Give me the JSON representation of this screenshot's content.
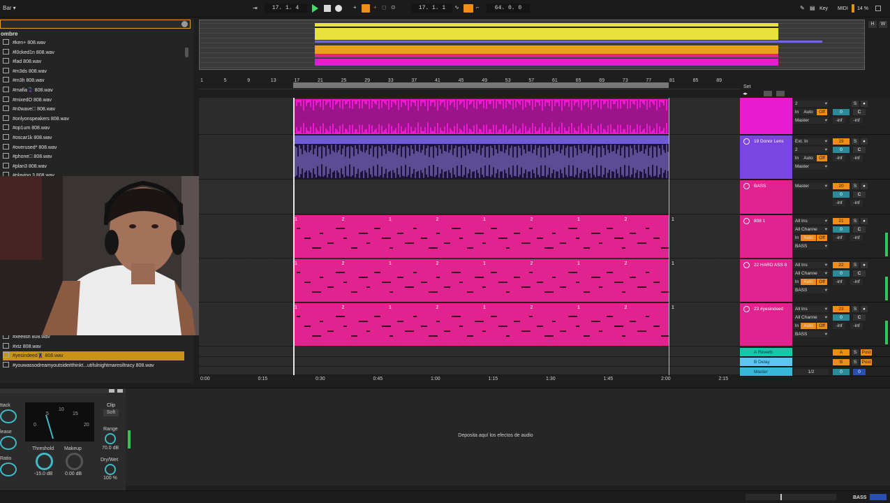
{
  "topbar": {
    "left_menu": "Bar",
    "arr_position": "17.  1.  4",
    "loop_start": "17.  1.  1",
    "loop_length": "64.  0.  0",
    "key_label": "Key",
    "midi_label": "MIDI",
    "cpu": "14 %",
    "btn_h": "H",
    "btn_w": "W"
  },
  "browser": {
    "column_header": "ombre",
    "files": [
      "#ken+ 808.wav",
      "#l0cked1n 808.wav",
      "#lad 808.wav",
      "#m3ds 808.wav",
      "#m3h 808.wav",
      "#mafia🦹 808.wav",
      "#mixedO 808.wav",
      "#n0wave🗆 808.wav",
      "#onlyonspeakers 808.wav",
      "#op1um 808.wav",
      "#oscar1k 808.wav",
      "#overused* 808.wav",
      "#phone🗆 808.wav",
      "#plan3 808.wav",
      "#playing 3 808.wav"
    ],
    "files_bottom": [
      "#xeelish 808.wav",
      "#xtz 808.wav"
    ],
    "selected_file": "#yesindeed🦹 808.wav",
    "last_file": "#youwassodreamyoutsideitthinkt...utifulnightmaresiltracy 808.wav"
  },
  "ruler": [
    "1",
    "5",
    "9",
    "13",
    "17",
    "21",
    "25",
    "29",
    "33",
    "37",
    "41",
    "45",
    "49",
    "53",
    "57",
    "61",
    "65",
    "69",
    "73",
    "77",
    "81",
    "85",
    "89"
  ],
  "time_ruler": [
    "0:00",
    "0:15",
    "0:30",
    "0:45",
    "1:00",
    "1:15",
    "1:30",
    "1:45",
    "2:00",
    "2:15"
  ],
  "clip_markers": [
    "1",
    "2",
    "1",
    "2",
    "1",
    "2",
    "1",
    "2",
    "1"
  ],
  "set_label": "Set",
  "tracks": [
    {
      "name": "",
      "color": "#ea1ad1",
      "in": "",
      "ch": "2",
      "monitor": [
        "In",
        "Auto",
        "Off"
      ],
      "out": "Master",
      "num": "",
      "vol": "0",
      "pan": "C",
      "a": "-inf",
      "b": "-inf"
    },
    {
      "name": "19 Donor Lens",
      "color": "#7b45e4",
      "in": "Ext. In",
      "ch": "2",
      "monitor": [
        "In",
        "Auto",
        "Off"
      ],
      "out": "Master",
      "num": "19",
      "vol": "0",
      "pan": "C",
      "a": "-inf",
      "b": "-inf"
    },
    {
      "name": "BASS",
      "color": "#e2238f",
      "in": "",
      "ch": "",
      "monitor": [],
      "out": "Master",
      "num": "20",
      "vol": "0",
      "pan": "C",
      "a": "-inf",
      "b": "-inf"
    },
    {
      "name": "808 1",
      "color": "#e2238f",
      "in": "All Ins",
      "ch": "All Channe",
      "monitor": [
        "In",
        "Auto",
        "Off"
      ],
      "out": "BASS",
      "num": "21",
      "vol": "0",
      "pan": "C",
      "a": "-inf",
      "b": "-inf"
    },
    {
      "name": "22 HARD ASS 8",
      "color": "#e2238f",
      "in": "All Ins",
      "ch": "All Channe",
      "monitor": [
        "In",
        "Auto",
        "Off"
      ],
      "out": "BASS",
      "num": "22",
      "vol": "0",
      "pan": "C",
      "a": "-inf",
      "b": "-inf"
    },
    {
      "name": "23 #yesindeed",
      "color": "#e2238f",
      "in": "All Ins",
      "ch": "All Channe",
      "monitor": [
        "In",
        "Auto",
        "Off"
      ],
      "out": "BASS",
      "num": "23",
      "vol": "0",
      "pan": "C",
      "a": "-inf",
      "b": "-inf"
    }
  ],
  "returns": [
    {
      "name": "A Reverb",
      "color": "#17c7a8",
      "letter": "A",
      "post": "Post"
    },
    {
      "name": "B Delay",
      "color": "#5cc6ef",
      "letter": "B",
      "post": "Post"
    },
    {
      "name": "Master",
      "color": "#37b8d7",
      "out": "1/2",
      "vol": "0",
      "pan": "0"
    }
  ],
  "compressor": {
    "attack_label": "ttack",
    "release_label": "lease",
    "ratio_label": "Ratio",
    "clip_label": "Clip",
    "soft_label": "Soft",
    "range_label": "Range",
    "range_value": "70.0 dB",
    "threshold_label": "Threshold",
    "threshold_value": "-15.0 dB",
    "makeup_label": "Makeup",
    "makeup_value": "0.00 dB",
    "drywet_label": "Dry/Wet",
    "drywet_value": "100 %",
    "scale": [
      "5",
      "10",
      "15",
      "20",
      "0"
    ]
  },
  "dropzone": "Deposita aquí los efectos de audio",
  "status": {
    "track": "BASS"
  },
  "colors": {
    "magenta": "#ea1ad1",
    "purple": "#7b45e4",
    "pink": "#e2238f",
    "yellow": "#e8e23c",
    "accent_orange": "#ef8c1a"
  }
}
